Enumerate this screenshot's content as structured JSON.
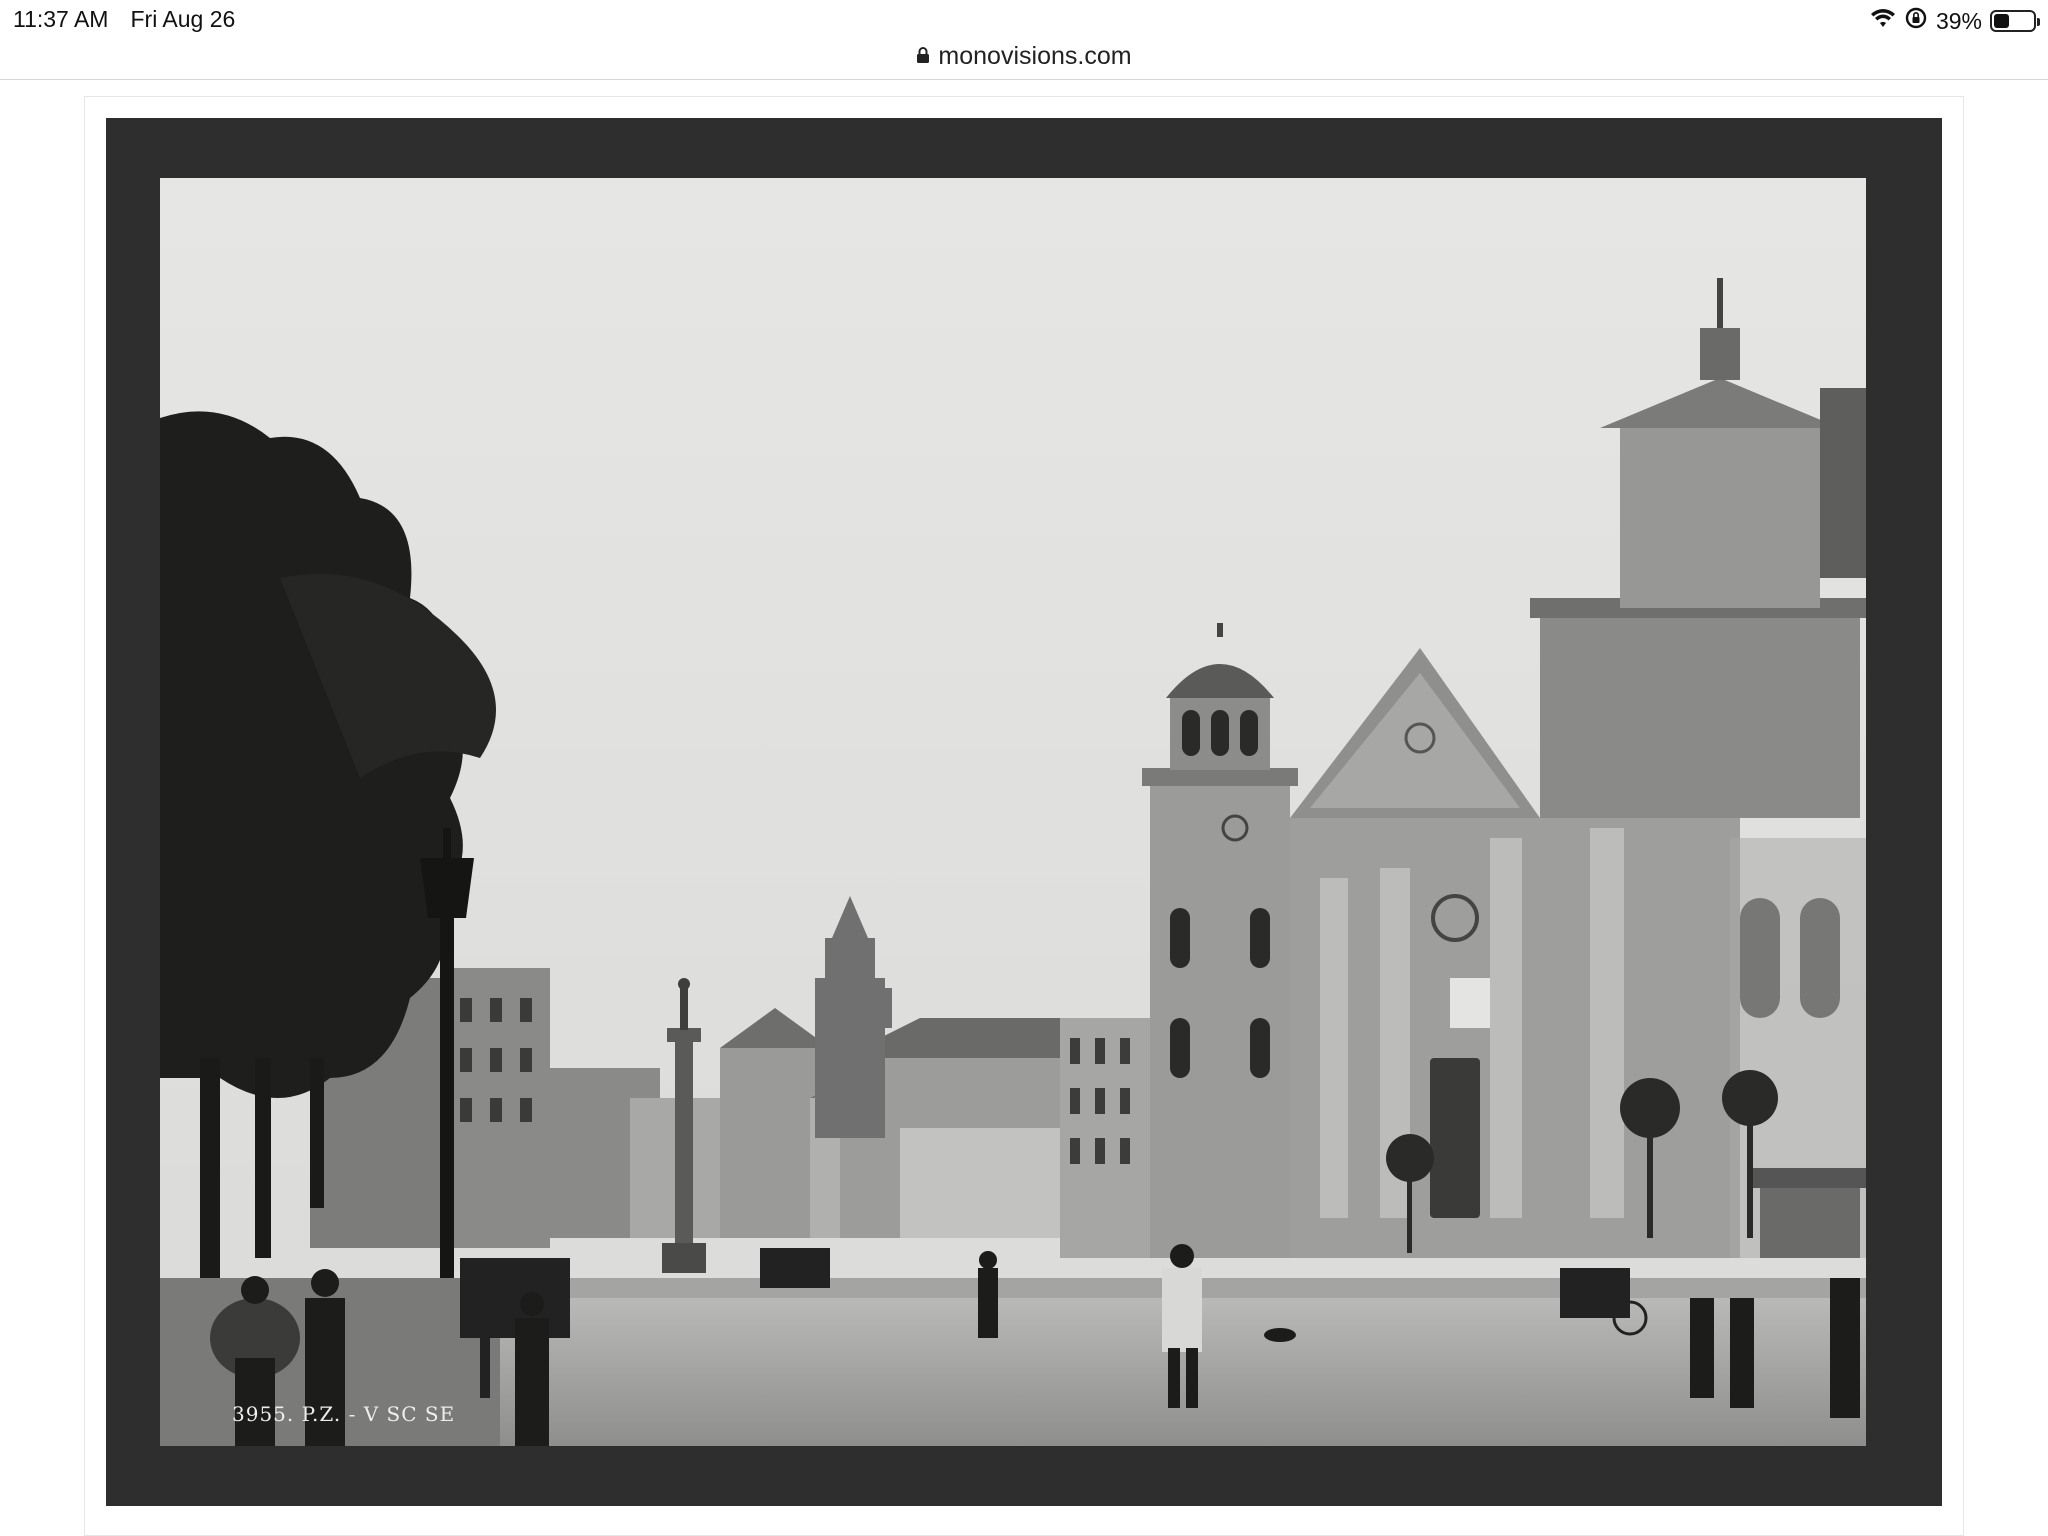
{
  "status_bar": {
    "time": "11:37 AM",
    "date": "Fri Aug 26",
    "battery_percent": "39%",
    "battery_level": 0.39,
    "wifi_icon": "wifi-icon",
    "rotation_lock_icon": "rotation-lock-icon"
  },
  "browser": {
    "url": "monovisions.com",
    "lock_icon": "lock-icon"
  },
  "photo": {
    "caption": "3955. P.Z. - V    SC          SE"
  },
  "colors": {
    "mount": "#2e2e2e",
    "sky": "#e2e2e0"
  }
}
